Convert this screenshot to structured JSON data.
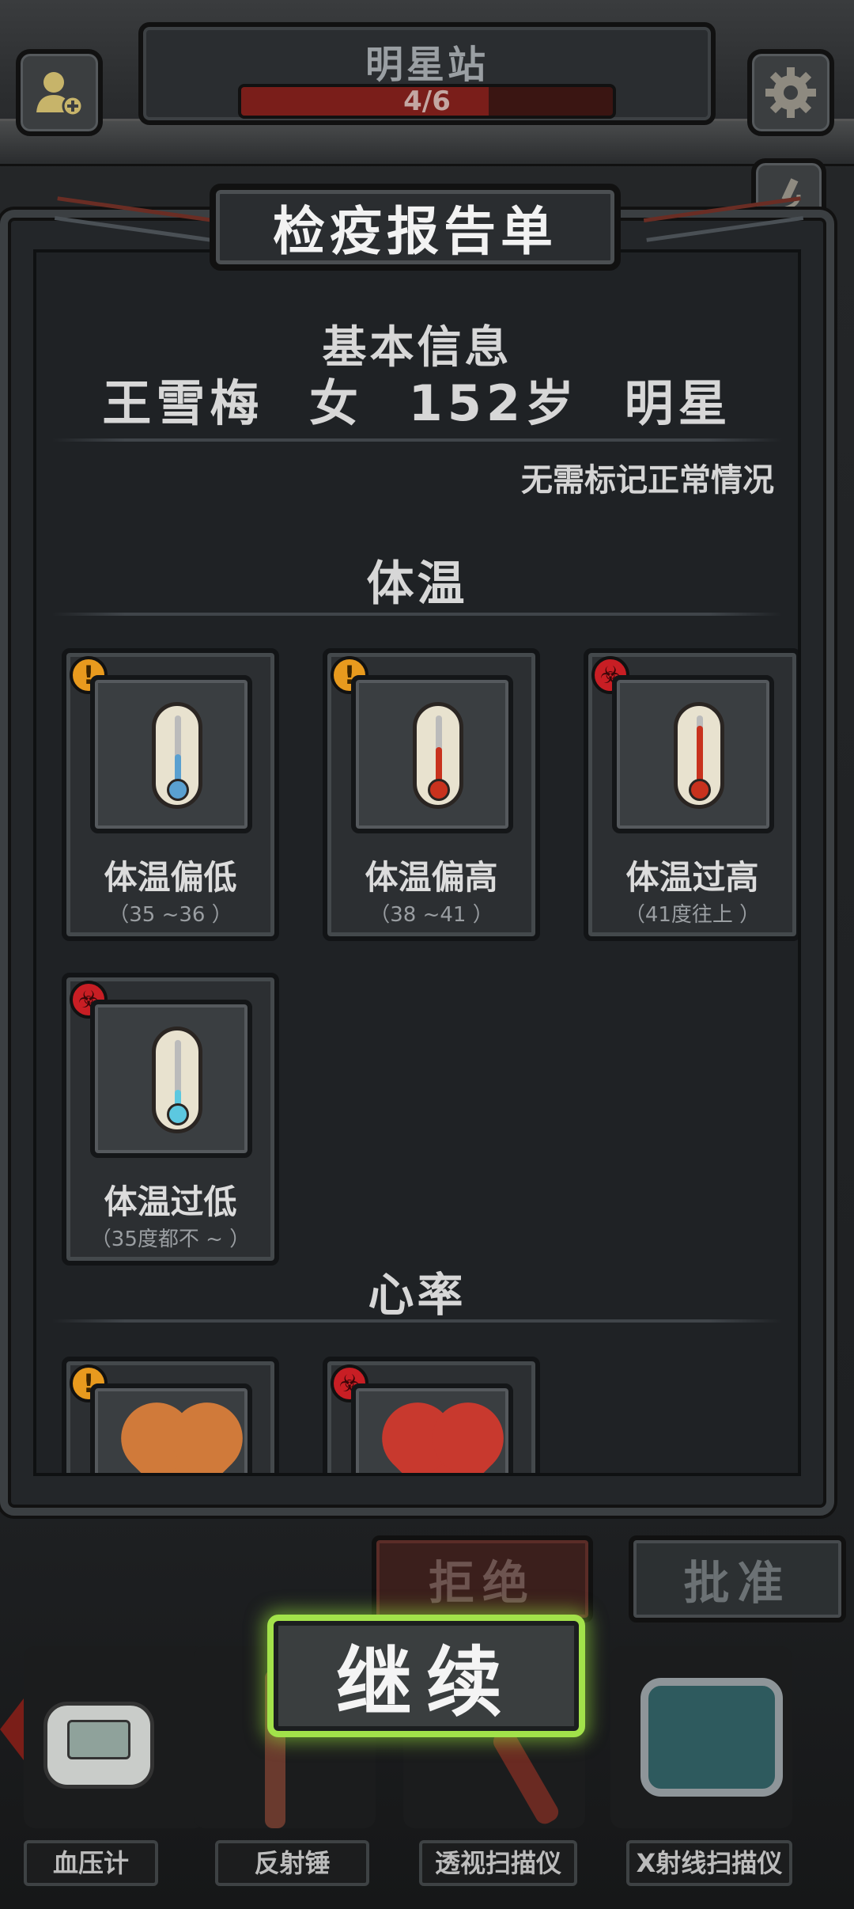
{
  "header": {
    "station_name": "明星站",
    "progress_text": "4/6",
    "progress_fraction": 0.667
  },
  "report": {
    "title": "检疫报告单",
    "basic_info_title": "基本信息",
    "basic_info": {
      "name": "王雪梅",
      "gender": "女",
      "age": "152岁",
      "type": "明星"
    },
    "note": "无需标记正常情况",
    "temperature": {
      "heading": "体温",
      "cards": [
        {
          "title": "体温偏低",
          "sub": "（35 ~36 ）",
          "badge": "warning-icon",
          "mercury_color": "#5aa0d0",
          "mercury_level": 0.45
        },
        {
          "title": "体温偏高",
          "sub": "（38 ~41 ）",
          "badge": "warning-icon",
          "mercury_color": "#c8321e",
          "mercury_level": 0.55
        },
        {
          "title": "体温过高",
          "sub": "（41度往上 ）",
          "badge": "biohazard-icon",
          "mercury_color": "#c8321e",
          "mercury_level": 0.85
        },
        {
          "title": "体温过低",
          "sub": "（35度都不 ~ ）",
          "badge": "biohazard-icon",
          "mercury_color": "#5cc8e0",
          "mercury_level": 0.3
        }
      ]
    },
    "heart_rate": {
      "heading": "心率",
      "cards": [
        {
          "badge": "warning-icon",
          "heart_color": "#d07a3a"
        },
        {
          "badge": "biohazard-icon",
          "heart_color": "#c8392e"
        }
      ]
    }
  },
  "actions": {
    "reject": "拒绝",
    "approve": "批准",
    "continue": "继续"
  },
  "tools": [
    {
      "label": "血压计",
      "icon": "blood-pressure-monitor-icon"
    },
    {
      "label": "反射锤",
      "icon": "reflex-hammer-icon"
    },
    {
      "label": "透视扫描仪",
      "icon": "scanner-icon"
    },
    {
      "label": "X射线扫描仪",
      "icon": "xray-scanner-icon"
    }
  ],
  "colors": {
    "continue_glow": "#a2e24a",
    "reject_bg": "#3b1f1c",
    "warning": "#e89a1e",
    "biohazard": "#c81e24"
  }
}
